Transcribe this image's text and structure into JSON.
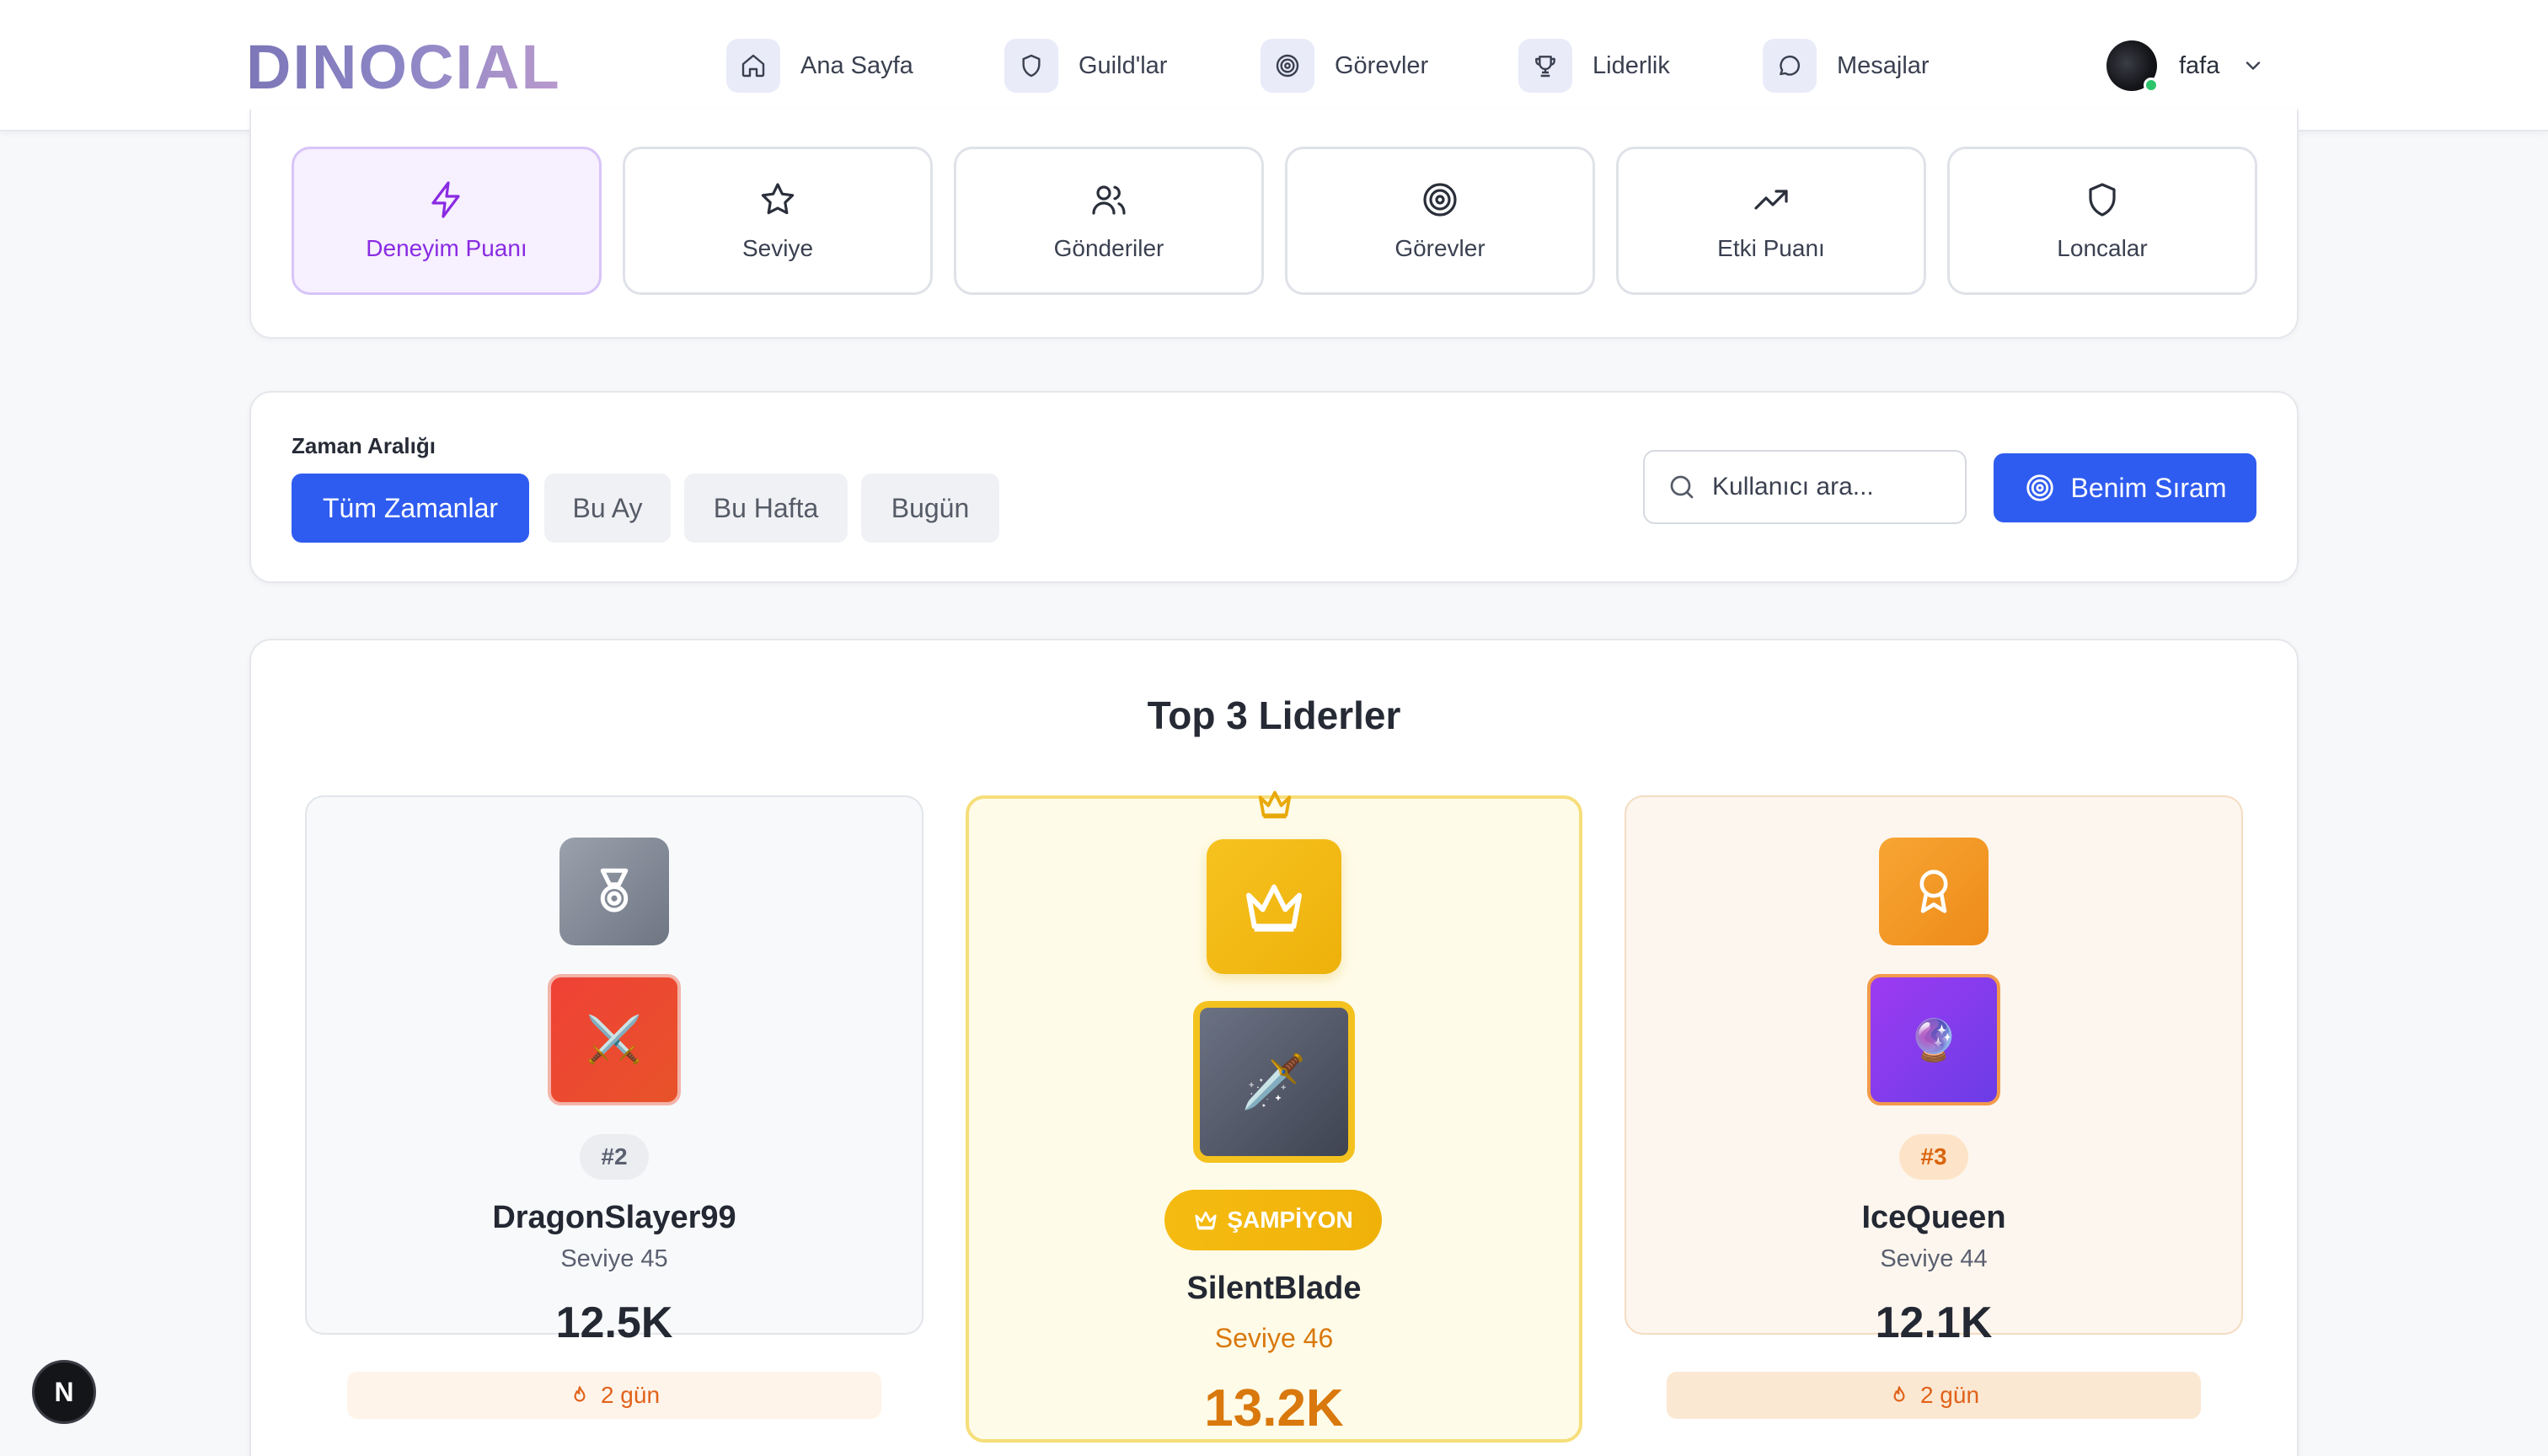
{
  "nav": {
    "logo": "DINOCIAL",
    "items": [
      {
        "label": "Ana Sayfa",
        "icon": "home-icon"
      },
      {
        "label": "Guild'lar",
        "icon": "shield-icon"
      },
      {
        "label": "Görevler",
        "icon": "target-icon"
      },
      {
        "label": "Liderlik",
        "icon": "trophy-icon"
      },
      {
        "label": "Mesajlar",
        "icon": "message-icon"
      }
    ],
    "user": {
      "name": "fafa",
      "status_color": "#2bc46a"
    }
  },
  "categories": [
    {
      "label": "Deneyim Puanı",
      "icon": "lightning-icon",
      "active": true
    },
    {
      "label": "Seviye",
      "icon": "star-icon"
    },
    {
      "label": "Gönderiler",
      "icon": "users-icon"
    },
    {
      "label": "Görevler",
      "icon": "target-icon"
    },
    {
      "label": "Etki Puanı",
      "icon": "trending-up-icon"
    },
    {
      "label": "Loncalar",
      "icon": "shield-icon"
    }
  ],
  "filters": {
    "label": "Zaman Aralığı",
    "ranges": [
      "Tüm Zamanlar",
      "Bu Ay",
      "Bu Hafta",
      "Bugün"
    ],
    "selected": "Tüm Zamanlar",
    "search_placeholder": "Kullanıcı ara...",
    "my_rank_label": "Benim Sıram"
  },
  "top3": {
    "title": "Top 3 Liderler",
    "second": {
      "rank": "#2",
      "name": "DragonSlayer99",
      "level": "Seviye 45",
      "score": "12.5K",
      "streak": "2 gün",
      "avatar_emoji": "⚔️"
    },
    "first": {
      "badge": "ŞAMPİYON",
      "name": "SilentBlade",
      "level": "Seviye 46",
      "score": "13.2K",
      "avatar_emoji": "🗡️"
    },
    "third": {
      "rank": "#3",
      "name": "IceQueen",
      "level": "Seviye 44",
      "score": "12.1K",
      "streak": "2 gün",
      "avatar_emoji": "🔮"
    }
  },
  "dev_badge": "N",
  "colors": {
    "accent": "#2f5cf0",
    "gold": "#f2b90f",
    "purple": "#8a2be2",
    "orange": "#f09222"
  }
}
